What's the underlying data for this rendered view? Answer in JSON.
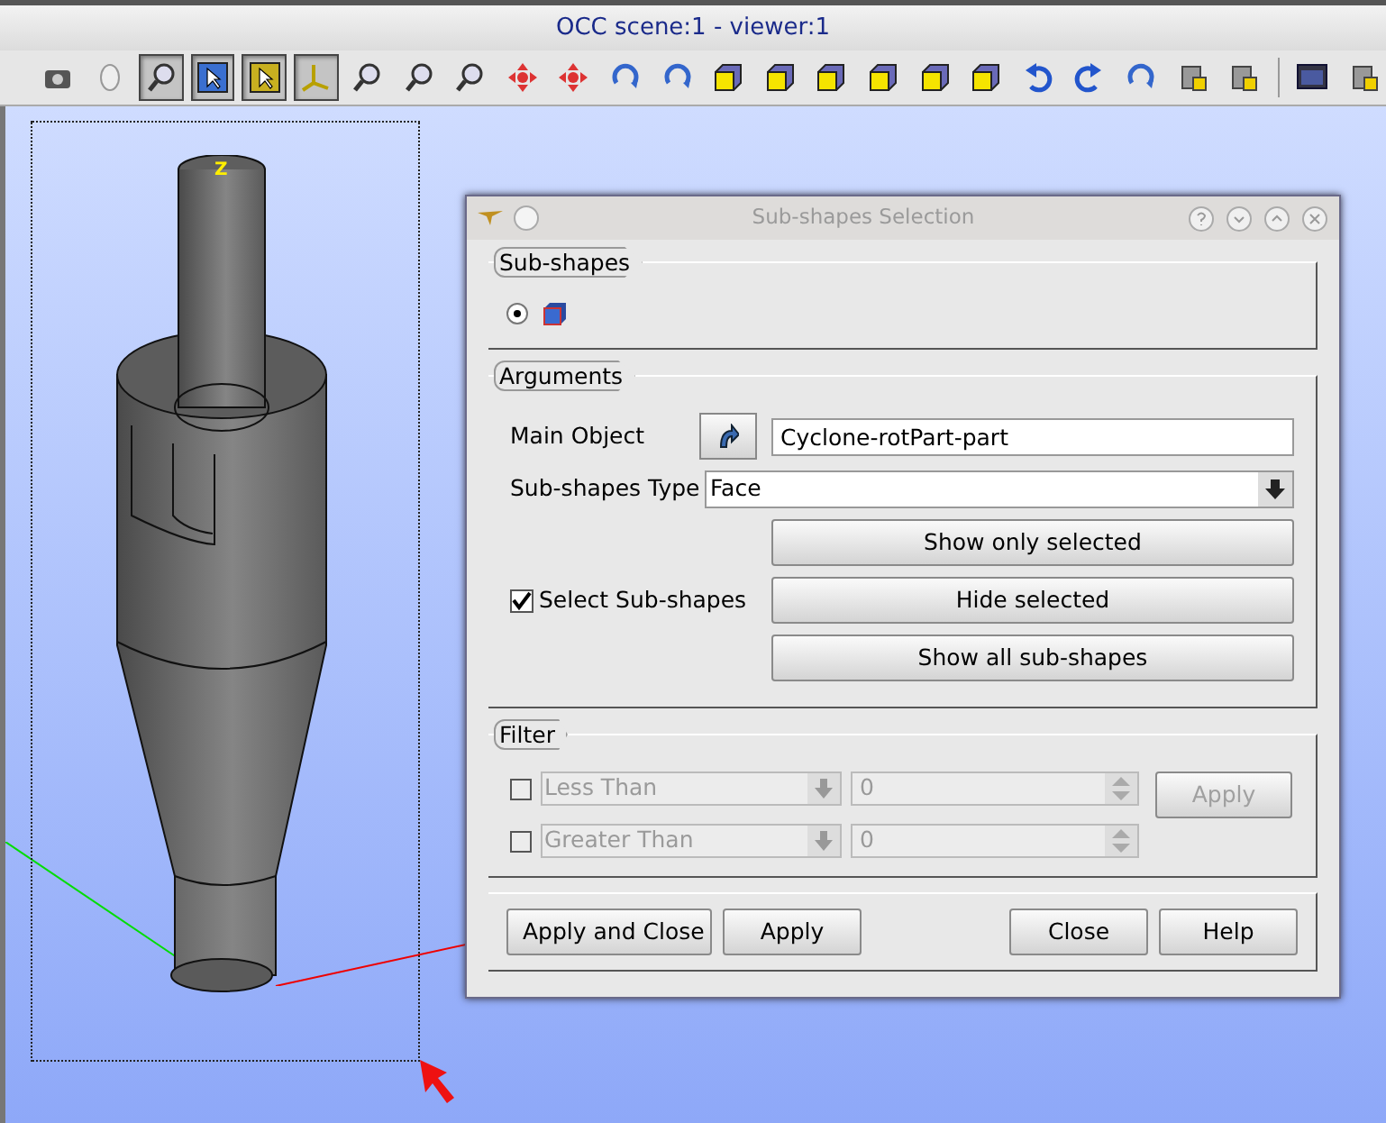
{
  "window": {
    "title": "OCC scene:1 - viewer:1"
  },
  "toolbar": [
    {
      "kind": "camera",
      "on": false
    },
    {
      "kind": "mouse",
      "on": false
    },
    {
      "kind": "zoomcross",
      "on": true
    },
    {
      "kind": "select",
      "on": true
    },
    {
      "kind": "selectyellow",
      "on": true
    },
    {
      "kind": "axes",
      "on": true
    },
    {
      "kind": "zoom",
      "on": false
    },
    {
      "kind": "zoom",
      "on": false
    },
    {
      "kind": "zoom",
      "on": false
    },
    {
      "kind": "pan",
      "on": false
    },
    {
      "kind": "pan",
      "on": false
    },
    {
      "kind": "rotate",
      "on": false
    },
    {
      "kind": "rotate",
      "on": false
    },
    {
      "kind": "cube",
      "on": false
    },
    {
      "kind": "cube",
      "on": false
    },
    {
      "kind": "cube",
      "on": false
    },
    {
      "kind": "cube",
      "on": false
    },
    {
      "kind": "cube",
      "on": false
    },
    {
      "kind": "cube",
      "on": false
    },
    {
      "kind": "undo",
      "on": false
    },
    {
      "kind": "redo",
      "on": false
    },
    {
      "kind": "rotate",
      "on": false
    },
    {
      "kind": "misc",
      "on": false
    },
    {
      "kind": "misc",
      "on": false
    },
    {
      "kind": "screen",
      "on": false
    },
    {
      "kind": "misc",
      "on": false
    }
  ],
  "viewer": {
    "axis_label": "Z"
  },
  "dialog": {
    "title": "Sub-shapes Selection",
    "subshapes": {
      "title": "Sub-shapes",
      "options": [
        {
          "selected": true
        }
      ]
    },
    "arguments": {
      "title": "Arguments",
      "main_object_label": "Main Object",
      "main_object_value": "Cyclone-rotPart-part",
      "type_label": "Sub-shapes Type",
      "type_value": "Face",
      "select_label": "Select Sub-shapes",
      "select_checked": true,
      "buttons": [
        "Show only selected",
        "Hide selected",
        "Show all sub-shapes"
      ]
    },
    "filter": {
      "title": "Filter",
      "rows": [
        {
          "checked": false,
          "condition": "Less Than",
          "value": "0",
          "disabled": true
        },
        {
          "checked": false,
          "condition": "Greater Than",
          "value": "0",
          "disabled": true
        }
      ],
      "apply": {
        "label": "Apply",
        "disabled": true
      }
    },
    "buttons_left": [
      "Apply and Close",
      "Apply"
    ],
    "buttons_right": [
      "Close",
      "Help"
    ]
  }
}
